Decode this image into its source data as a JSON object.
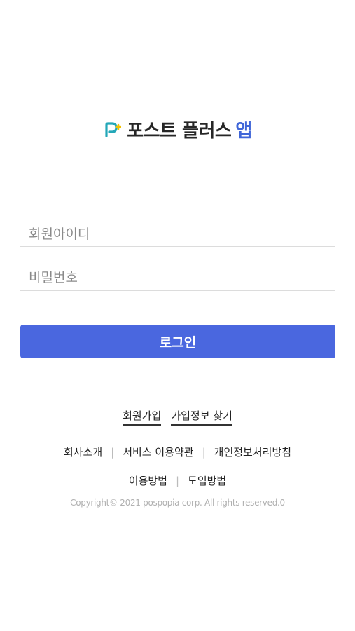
{
  "logo": {
    "title": "포스트 플러스",
    "accent": "앱",
    "mark_icon": "pp-logo-icon",
    "accent_color": "#3f66d8"
  },
  "login": {
    "id_placeholder": "회원아이디",
    "id_value": "",
    "pw_placeholder": "비밀번호",
    "pw_value": "",
    "button_label": "로그인",
    "button_color": "#4a67df"
  },
  "account_links": {
    "signup": "회원가입",
    "find_info": "가입정보 찾기"
  },
  "footer": {
    "row1": [
      "회사소개",
      "서비스 이용약관",
      "개인정보처리방침"
    ],
    "row2": [
      "이용방법",
      "도입방법"
    ],
    "separator": "|",
    "copyright": "Copyright© 2021 pospopia corp. All rights reserved.0"
  }
}
